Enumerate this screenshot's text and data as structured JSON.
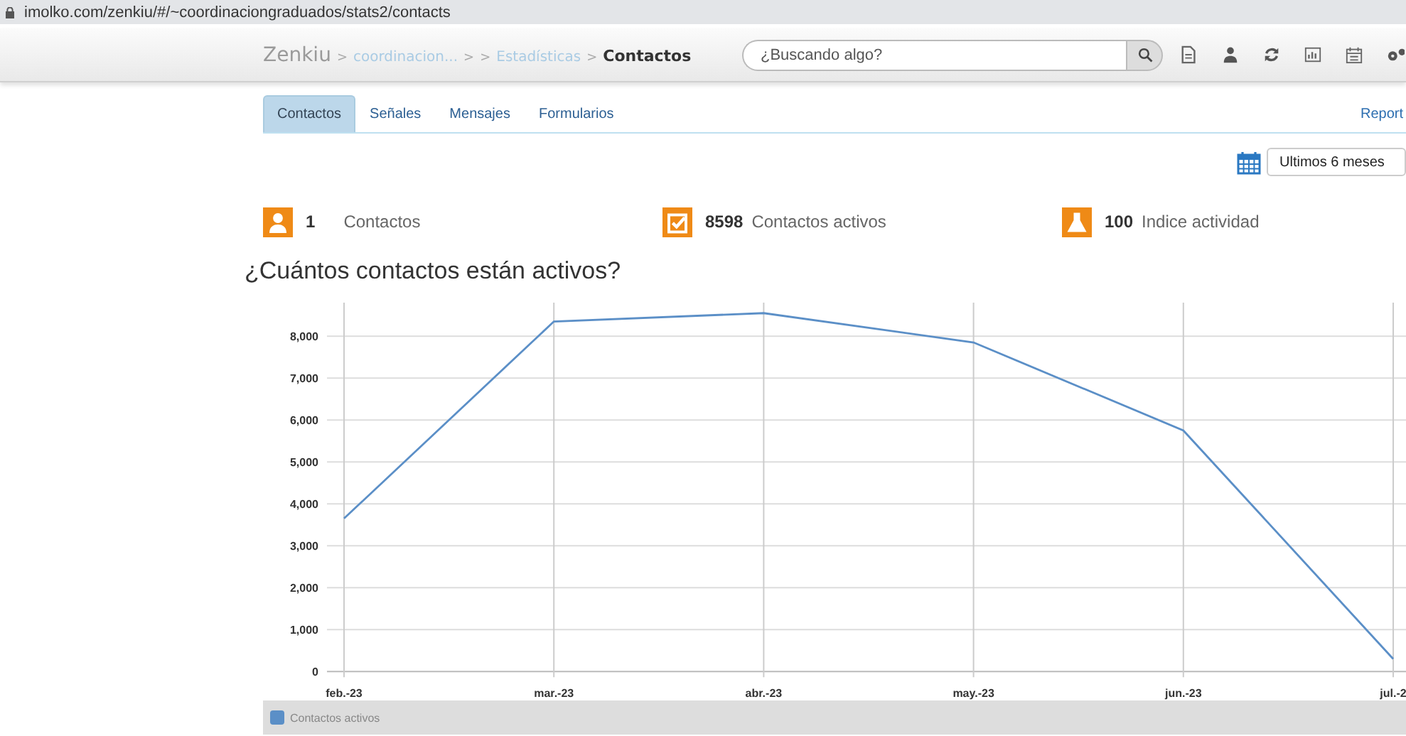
{
  "address_bar": {
    "url": "imolko.com/zenkiu/#/~coordinaciongraduados/stats2/contacts"
  },
  "header": {
    "breadcrumb": [
      {
        "text": "Zenkiu",
        "kind": "brand"
      },
      {
        "text": ">",
        "kind": "sep"
      },
      {
        "text": "coordinacion...",
        "kind": "link"
      },
      {
        "text": ">",
        "kind": "sep"
      },
      {
        "text": ">",
        "kind": "sep"
      },
      {
        "text": "Estadísticas",
        "kind": "link"
      },
      {
        "text": ">",
        "kind": "sep"
      },
      {
        "text": "Contactos",
        "kind": "current"
      }
    ],
    "search": {
      "placeholder": "¿Buscando algo?"
    },
    "toolbar": [
      {
        "kind": "file"
      },
      {
        "kind": "user"
      },
      {
        "kind": "refresh"
      },
      {
        "kind": "chart"
      },
      {
        "kind": "calendar"
      },
      {
        "kind": "gears"
      }
    ]
  },
  "tabs": [
    {
      "label": "Contactos",
      "selected": true
    },
    {
      "label": "Señales",
      "selected": false
    },
    {
      "label": "Mensajes",
      "selected": false
    },
    {
      "label": "Formularios",
      "selected": false
    }
  ],
  "report_link": "Report",
  "date_range": {
    "value": "Ultimos 6 meses"
  },
  "stats": [
    {
      "kind": "user",
      "value": "1",
      "label": "Contactos"
    },
    {
      "kind": "check",
      "value": "8598",
      "label": "Contactos activos"
    },
    {
      "kind": "flask",
      "value": "100",
      "label": "Indice actividad"
    }
  ],
  "chart": {
    "title": "¿Cuántos contactos están activos?",
    "chart_data": {
      "type": "line",
      "categories": [
        "feb.-23",
        "mar.-23",
        "abr.-23",
        "may.-23",
        "jun.-23",
        "jul.-2"
      ],
      "ylim": [
        0,
        8800
      ],
      "grid": true,
      "yticks": [
        {
          "value": 0,
          "label": "0"
        },
        {
          "value": 1000,
          "label": "1,000"
        },
        {
          "value": 2000,
          "label": "2,000"
        },
        {
          "value": 3000,
          "label": "3,000"
        },
        {
          "value": 4000,
          "label": "4,000"
        },
        {
          "value": 5000,
          "label": "5,000"
        },
        {
          "value": 6000,
          "label": "6,000"
        },
        {
          "value": 7000,
          "label": "7,000"
        },
        {
          "value": 8000,
          "label": "8,000"
        }
      ],
      "series": [
        {
          "name": "Contactos activos",
          "color": "#5b8fc7",
          "values": [
            3650,
            8350,
            8550,
            7850,
            5750,
            300
          ]
        }
      ]
    }
  }
}
